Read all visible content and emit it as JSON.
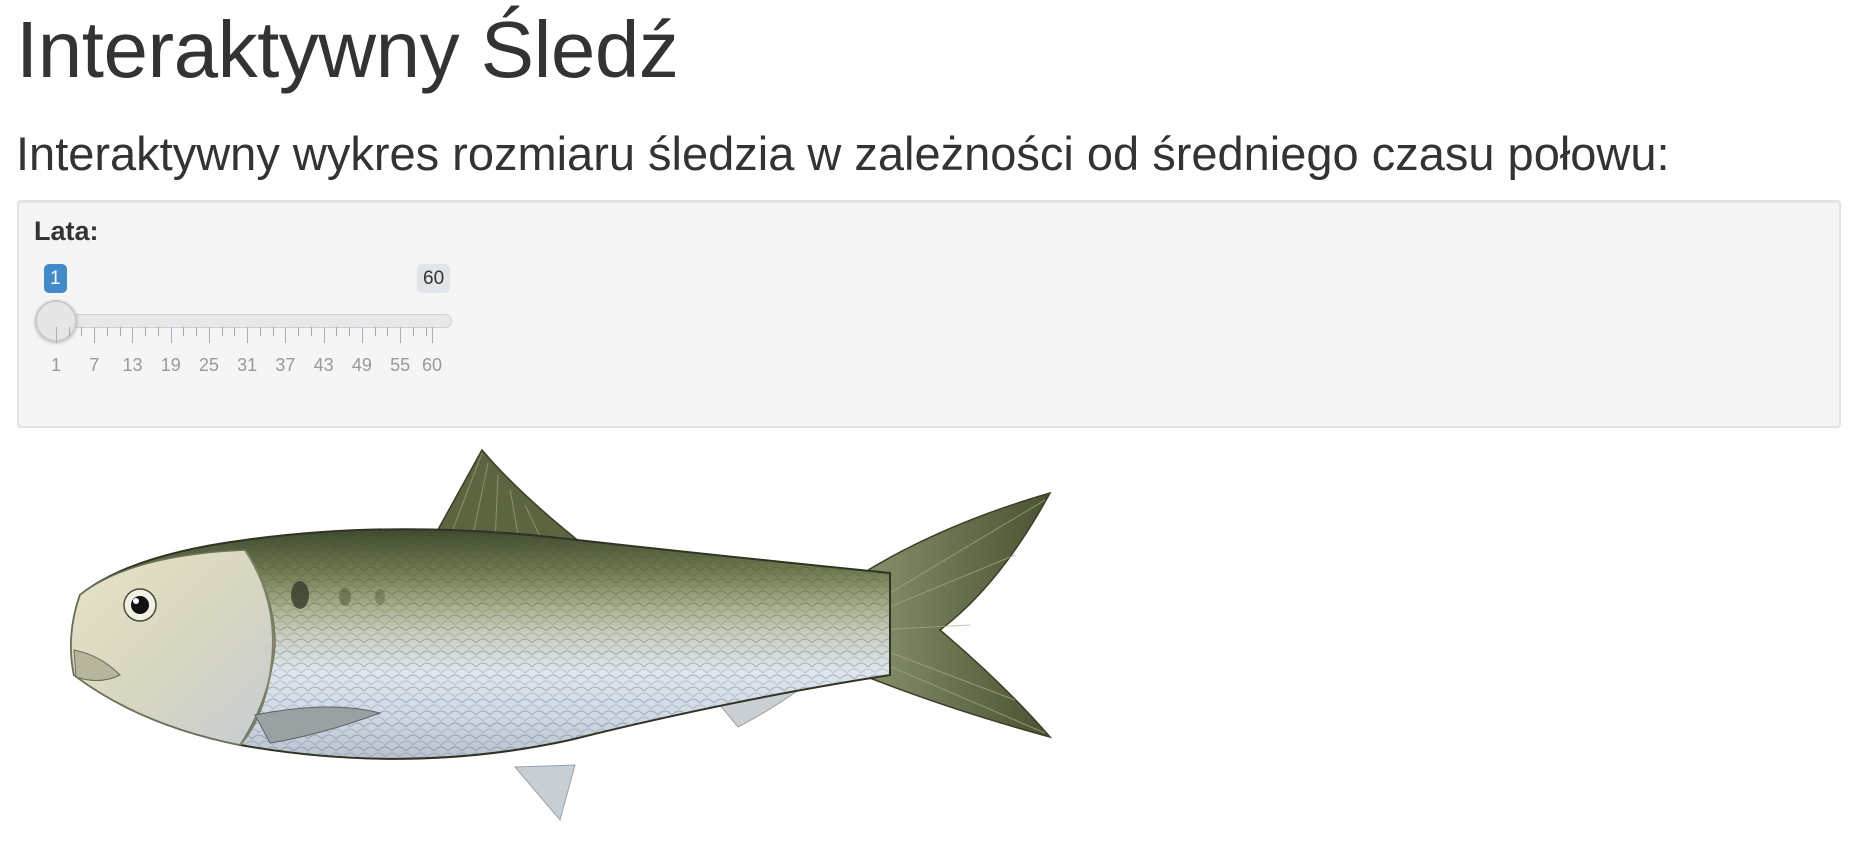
{
  "header": {
    "title": "Interaktywny Śledź",
    "subtitle": "Interaktywny wykres rozmiaru śledzia w zależności od średniego czasu połowu:"
  },
  "slider": {
    "label": "Lata:",
    "min": 1,
    "max": 60,
    "value": 1,
    "value_label": "1",
    "max_label": "60",
    "tick_labels": [
      "1",
      "7",
      "13",
      "19",
      "25",
      "31",
      "37",
      "43",
      "49",
      "55",
      "60"
    ],
    "accent_color": "#428bca"
  },
  "image": {
    "subject": "herring-fish-illustration"
  }
}
